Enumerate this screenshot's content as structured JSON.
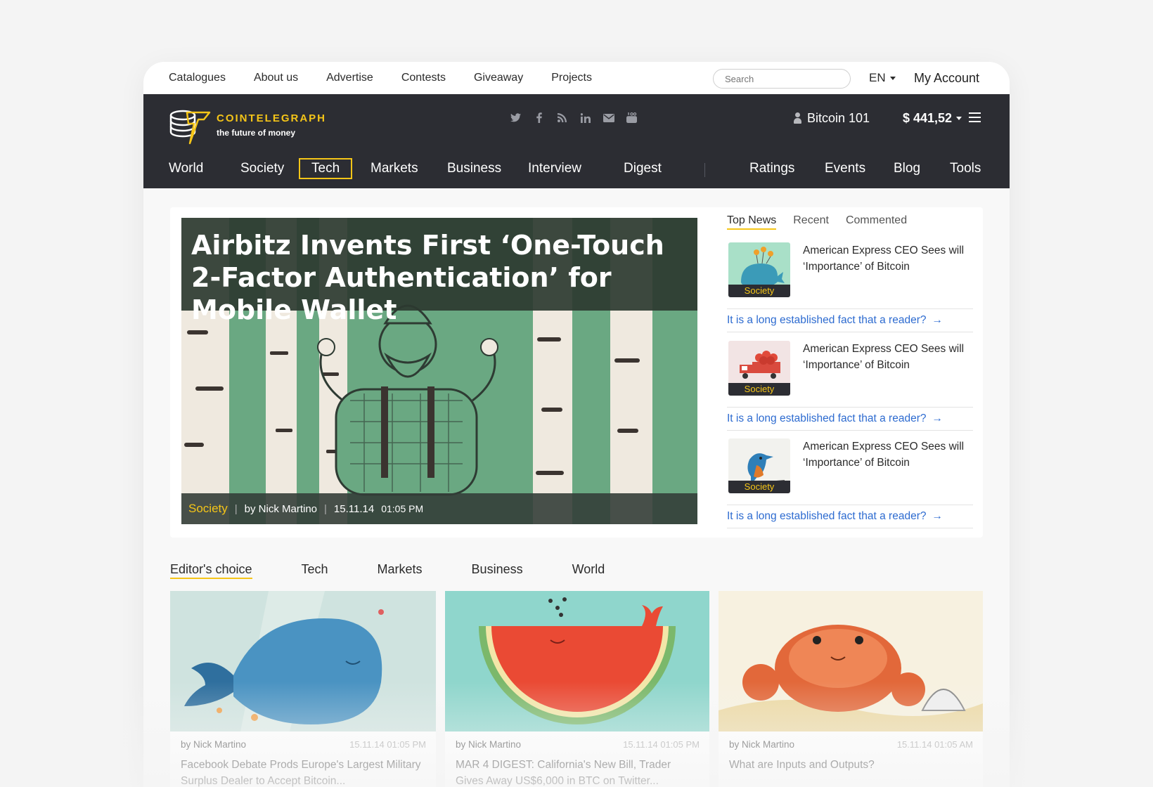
{
  "utility_nav": {
    "items": [
      "Catalogues",
      "About us",
      "Advertise",
      "Contests",
      "Giveaway",
      "Projects"
    ],
    "search_placeholder": "Search",
    "language": "EN",
    "account": "My Account"
  },
  "header": {
    "brand": "COINTELEGRAPH",
    "tagline": "the future of money",
    "bitcoin101": "Bitcoin 101",
    "price": "$ 441,52",
    "socials": [
      "twitter-icon",
      "facebook-icon",
      "rss-icon",
      "linkedin-icon",
      "mail-icon",
      "youtube-icon"
    ]
  },
  "main_nav": {
    "items": [
      "World",
      "Society",
      "Tech",
      "Markets",
      "Business",
      "Interview",
      "Digest",
      "Ratings",
      "Events",
      "Blog",
      "Tools"
    ],
    "active": "Tech"
  },
  "hero": {
    "title": "Airbitz Invents First ‘One-Touch 2-Factor Authentication’ for Mobile Wallet",
    "category": "Society",
    "author": "by Nick Martino",
    "date": "15.11.14",
    "time": "01:05 PM"
  },
  "news_tabs": [
    "Top News",
    "Recent",
    "Commented"
  ],
  "news": [
    {
      "title": "American Express CEO Sees will ‘Importance’ of Bitcoin",
      "tag": "Society",
      "link": "It is a long established fact that a reader?"
    },
    {
      "title": "American Express CEO Sees will ‘Importance’ of Bitcoin",
      "tag": "Society",
      "link": "It is a long established fact that a reader?"
    },
    {
      "title": "American Express CEO Sees will ‘Importance’ of Bitcoin",
      "tag": "Society",
      "link": "It is a long established fact that a reader?"
    }
  ],
  "section_tabs": [
    "Editor's choice",
    "Tech",
    "Markets",
    "Business",
    "World"
  ],
  "articles": [
    {
      "author": "by Nick Martino",
      "date": "15.11.14   01:05 PM",
      "title": "Facebook Debate Prods Europe's Largest Military Surplus Dealer to Accept Bitcoin..."
    },
    {
      "author": "by Nick Martino",
      "date": "15.11.14   01:05 PM",
      "title": "MAR 4 DIGEST: California's New Bill, Trader Gives Away US$6,000 in BTC on Twitter..."
    },
    {
      "author": "by Nick Martino",
      "date": "15.11.14   01:05 AM",
      "title": "What are Inputs and Outputs?"
    }
  ],
  "colors": {
    "accent": "#f5c518",
    "header_bg": "#2c2d33",
    "link": "#2d6bd0"
  }
}
